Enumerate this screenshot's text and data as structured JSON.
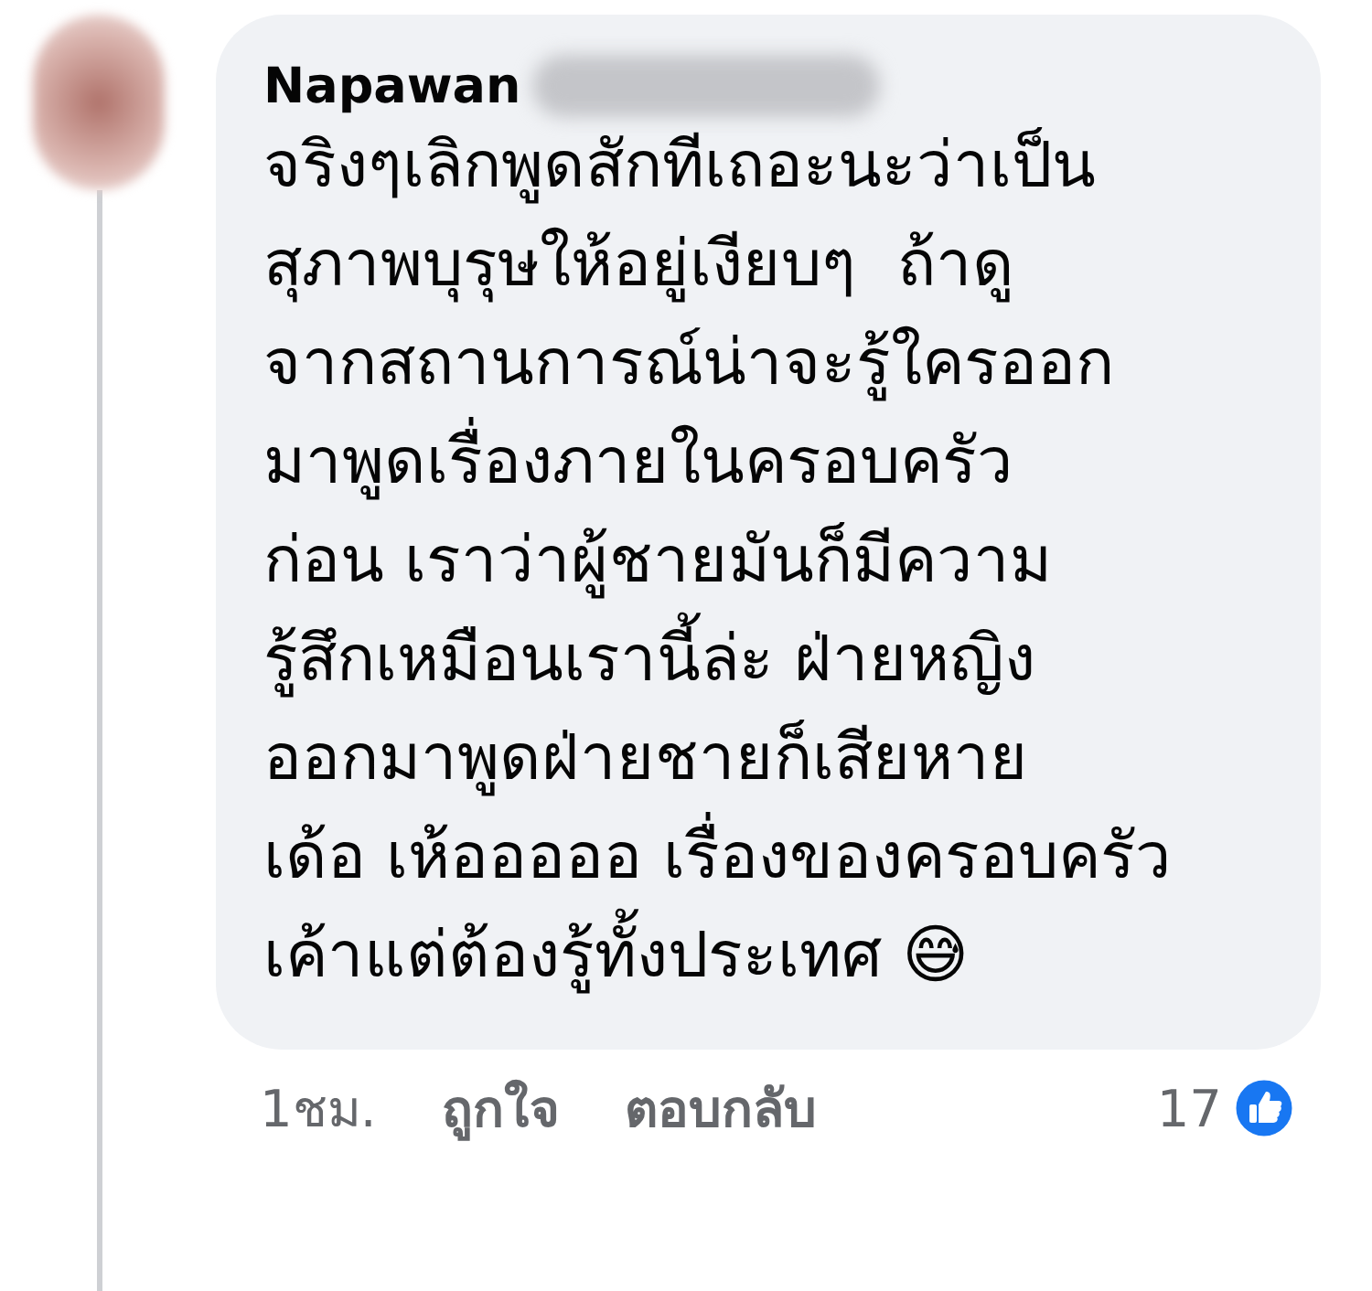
{
  "comment": {
    "author": "Napawan",
    "lines": [
      "จริงๆเลิกพูดสักทีเถอะนะว่าเป็น",
      "สุภาพบุรุษให้อยู่เงียบๆ  ถ้าดู",
      "จากสถานการณ์น่าจะรู้ใครออก",
      "มาพูดเรื่องภายในครอบครัว",
      "ก่อน เราว่าผู้ชายมันก็มีความ",
      "รู้สึกเหมือนเรานี้ล่ะ ฝ่ายหญิง",
      "ออกมาพูดฝ่ายชายก็เสียหาย",
      "เด้อ เห้อออออ เรื่องของครอบครัว",
      "เค้าแต่ต้องรู้ทั้งประเทศ 😅"
    ],
    "time": "1ชม.",
    "actions": [
      "ถูกใจ",
      "ตอบกลับ"
    ],
    "reaction_count": "17"
  }
}
